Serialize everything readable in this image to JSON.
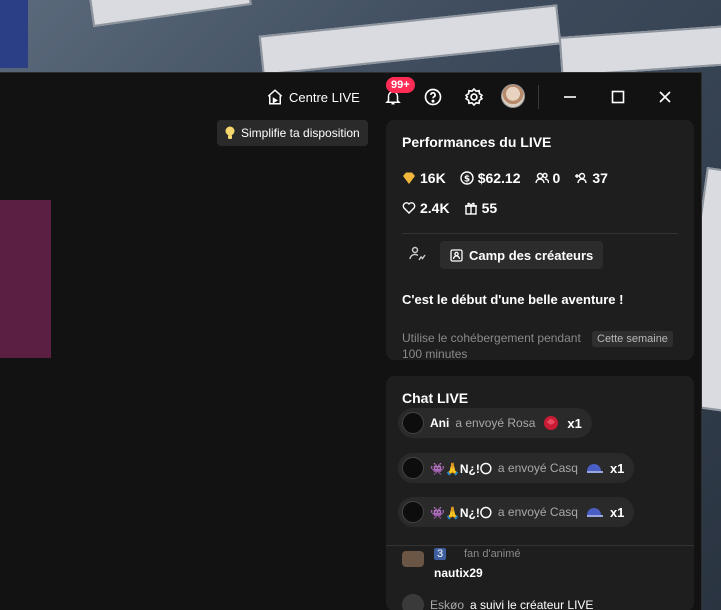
{
  "titlebar": {
    "home_label": "Centre LIVE",
    "notifications_badge": "99+"
  },
  "tip": {
    "label": "Simplifie ta disposition"
  },
  "performance": {
    "title": "Performances du LIVE",
    "diamonds": "16K",
    "earnings": "$62.12",
    "viewers": "0",
    "new_followers": "37",
    "likes": "2.4K",
    "gifters": "55",
    "creator_camp_label": "Camp des créateurs",
    "adventure_text": "C'est le début d'une belle aventure !",
    "task_text": "Utilise le cohébergement pendant 100 minutes",
    "task_badge": "Cette semaine"
  },
  "chat": {
    "title": "Chat LIVE",
    "gifts": [
      {
        "name": "Ani",
        "verb": "a envoyé Rosa",
        "count": "x1",
        "gift_icon": "rose-icon"
      },
      {
        "name": "👾🙏N¿!〇",
        "verb": "a envoyé Casq",
        "count": "x1",
        "gift_icon": "cap-icon"
      },
      {
        "name": "👾🙏N¿!〇",
        "verb": "a envoyé Casq",
        "count": "x1",
        "gift_icon": "cap-icon"
      }
    ],
    "message": {
      "badge": "3",
      "fan_label": "fan d'animé",
      "user": "nautix29"
    },
    "follow": {
      "name": "Eskøo",
      "text": "a suivi le créateur LIVE"
    }
  },
  "colors": {
    "window_bg": "#121212",
    "panel_bg": "#1e1e1e",
    "accent": "#fe2c55"
  }
}
